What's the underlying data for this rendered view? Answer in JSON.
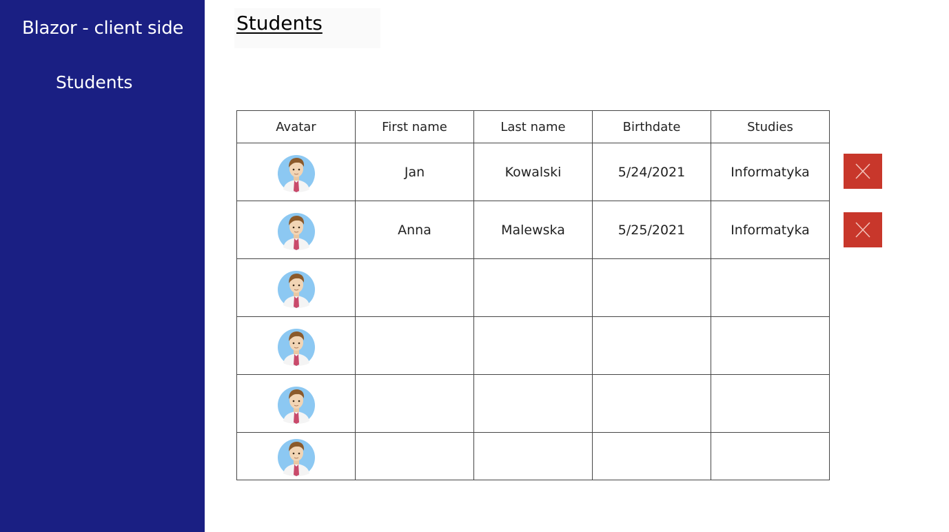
{
  "sidebar": {
    "brand": "Blazor - client side",
    "nav": [
      {
        "label": "Students"
      }
    ]
  },
  "page": {
    "title": "Students"
  },
  "table": {
    "columns": [
      "Avatar",
      "First name",
      "Last name",
      "Birthdate",
      "Studies"
    ],
    "rows": [
      {
        "avatar": "student-avatar-icon",
        "first_name": "Jan",
        "last_name": "Kowalski",
        "birthdate": "5/24/2021",
        "studies": "Informatyka",
        "delete_icon": "close-icon"
      },
      {
        "avatar": "student-avatar-icon",
        "first_name": "Anna",
        "last_name": "Malewska",
        "birthdate": "5/25/2021",
        "studies": "Informatyka",
        "delete_icon": "close-icon"
      },
      {
        "avatar": "student-avatar-icon",
        "first_name": "",
        "last_name": "",
        "birthdate": "",
        "studies": ""
      },
      {
        "avatar": "student-avatar-icon",
        "first_name": "",
        "last_name": "",
        "birthdate": "",
        "studies": ""
      },
      {
        "avatar": "student-avatar-icon",
        "first_name": "",
        "last_name": "",
        "birthdate": "",
        "studies": ""
      },
      {
        "avatar": "student-avatar-icon",
        "first_name": "",
        "last_name": "",
        "birthdate": "",
        "studies": ""
      }
    ]
  },
  "colors": {
    "sidebar_bg": "#1a1f83",
    "delete_button": "#c8372b"
  }
}
